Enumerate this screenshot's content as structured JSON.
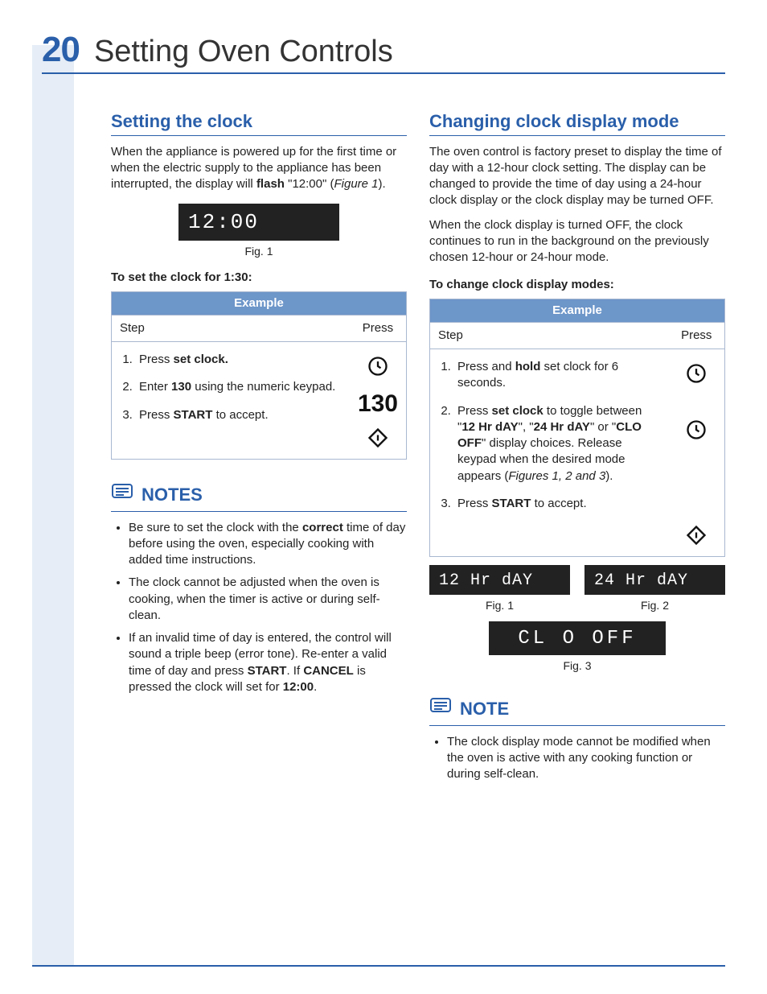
{
  "page": {
    "number": "20",
    "title": "Setting Oven Controls"
  },
  "left": {
    "heading": "Setting the clock",
    "intro_a": "When the appliance is powered up for the first time or when the electric supply to the appliance has been interrupted, the display will ",
    "intro_flash": "flash",
    "intro_b": " \"12:00\" (",
    "intro_figref": "Figure 1",
    "intro_c": ").",
    "display_1200": "12:00",
    "fig1_caption": "Fig. 1",
    "subhead": "To set the clock for 1:30:",
    "example_label": "Example",
    "col_step": "Step",
    "col_press": "Press",
    "step1_a": "Press ",
    "step1_b": "set clock.",
    "step2_a": "Enter ",
    "step2_b": "130",
    "step2_c": " using the  numeric keypad.",
    "step3_a": "Press ",
    "step3_b": "START",
    "step3_c": " to accept.",
    "press_130": "130",
    "notes_label": "NOTES",
    "note1_a": "Be sure to set the clock with the ",
    "note1_b": "correct",
    "note1_c": " time of day before using the oven, especially cooking with added time instructions.",
    "note2": "The clock cannot be adjusted when the oven is cooking, when the timer is active or during self-clean.",
    "note3_a": "If an invalid time of day is entered, the control will sound a triple beep (error tone). Re-enter a valid time of day and press ",
    "note3_b": "START",
    "note3_c": ". If ",
    "note3_d": "CANCEL",
    "note3_e": " is pressed the clock will set for ",
    "note3_f": "12:00",
    "note3_g": "."
  },
  "right": {
    "heading": "Changing clock display mode",
    "para1": "The oven control is factory preset to display the time of day with a 12-hour clock setting. The display can be changed to provide the time of day using a 24-hour clock display or the clock display may be turned OFF.",
    "para2": "When the clock display is turned OFF, the clock continues to run in the background on the previously chosen 12-hour or 24-hour mode.",
    "subhead": "To change clock display modes:",
    "example_label": "Example",
    "col_step": "Step",
    "col_press": "Press",
    "step1_a": "Press and ",
    "step1_b": "hold",
    "step1_c": " set clock for 6 seconds.",
    "step2_a": "Press ",
    "step2_b": "set clock",
    "step2_c": " to toggle between \"",
    "step2_d": "12 Hr dAY",
    "step2_e": "\", \"",
    "step2_f": "24 Hr dAY",
    "step2_g": "\" or \"",
    "step2_h": "CLO OFF",
    "step2_i": "\" display choices. Release keypad when the desired mode appears (",
    "step2_j": "Figures 1, 2 and 3",
    "step2_k": ").",
    "step3_a": "Press ",
    "step3_b": "START",
    "step3_c": " to accept.",
    "disp12": "12 Hr  dAY",
    "disp24": "24 Hr  dAY",
    "dispoff": "CL O   OFF",
    "fig1": "Fig. 1",
    "fig2": "Fig. 2",
    "fig3": "Fig. 3",
    "note_label": "NOTE",
    "note_text": "The clock display mode cannot be modified when the oven is active with any cooking function or during self-clean."
  }
}
